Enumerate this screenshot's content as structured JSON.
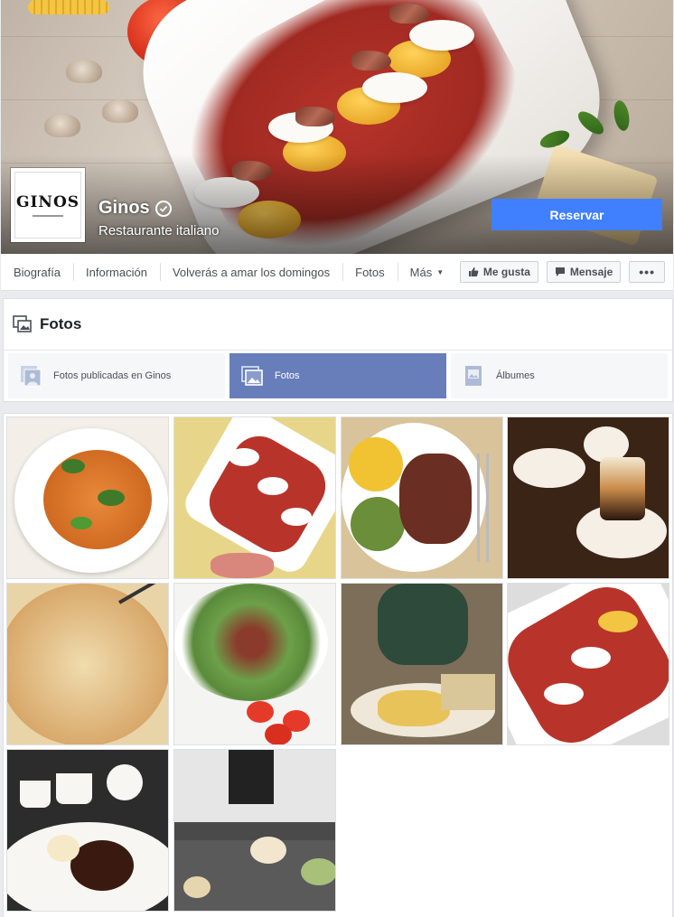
{
  "page": {
    "name": "Ginos",
    "category": "Restaurante italiano",
    "logo_text": "GINOS",
    "reserve_label": "Reservar"
  },
  "nav": {
    "items": [
      "Biografía",
      "Información",
      "Volverás a amar los domingos",
      "Fotos",
      "Más"
    ],
    "like_label": "Me gusta",
    "message_label": "Mensaje",
    "more_label": "•••"
  },
  "photos": {
    "title": "Fotos",
    "subtabs": [
      {
        "label": "Fotos publicadas en Ginos",
        "active": false,
        "icon": "photos-stack-icon"
      },
      {
        "label": "Fotos",
        "active": true,
        "icon": "photo-icon"
      },
      {
        "label": "Álbumes",
        "active": false,
        "icon": "album-icon"
      }
    ],
    "thumbnails": [
      {
        "subject": "gnocchi-pesto",
        "colors": [
          "#f3efe8",
          "#e8893a",
          "#3f7a2a"
        ]
      },
      {
        "subject": "polenta-plate",
        "colors": [
          "#e7d68a",
          "#ffffff",
          "#b8342a"
        ]
      },
      {
        "subject": "pasta-meat",
        "colors": [
          "#d9c39b",
          "#f1c232",
          "#6b8e3a"
        ]
      },
      {
        "subject": "coffee-dessert",
        "colors": [
          "#3a2416",
          "#f5efe6",
          "#c98b4a"
        ]
      },
      {
        "subject": "pizza",
        "colors": [
          "#e9d4a8",
          "#d8a86a",
          "#9c5a3a"
        ]
      },
      {
        "subject": "salad",
        "colors": [
          "#f4f4f2",
          "#6da04a",
          "#8a3b2b"
        ]
      },
      {
        "subject": "fried-snacks",
        "colors": [
          "#7c6e58",
          "#e8c35a",
          "#efe7d8"
        ]
      },
      {
        "subject": "polenta-plate-2",
        "colors": [
          "#ffffff",
          "#b8342a",
          "#f4c542"
        ]
      },
      {
        "subject": "chocolate-cake",
        "colors": [
          "#2c2c2c",
          "#f8f6f2",
          "#3a1a10"
        ]
      },
      {
        "subject": "kitchen-pasta",
        "colors": [
          "#4a4a4a",
          "#e6d6b0",
          "#a9c07a"
        ]
      }
    ]
  },
  "colors": {
    "brand_blue": "#4080ff",
    "active_tab": "#687ebb",
    "bg": "#e9ebee"
  }
}
